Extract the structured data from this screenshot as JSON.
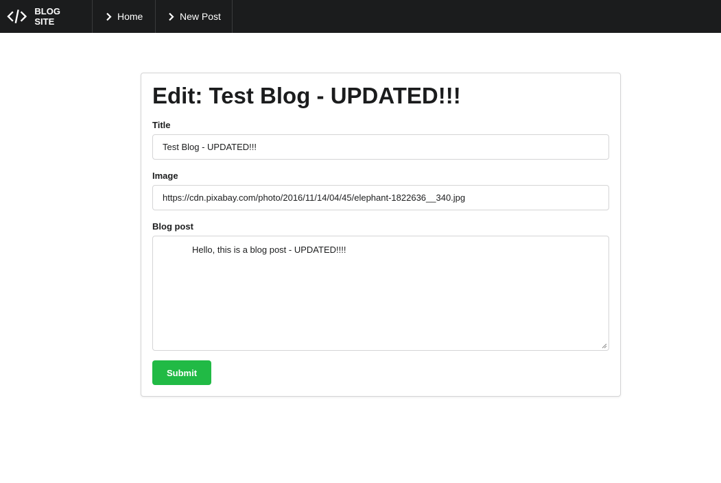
{
  "nav": {
    "brand": "BLOG SITE",
    "brand_icon": "code-icon",
    "items": [
      {
        "label": "Home",
        "icon": "chevron-right-icon"
      },
      {
        "label": "New Post",
        "icon": "chevron-right-icon"
      }
    ]
  },
  "form": {
    "heading": "Edit: Test Blog - UPDATED!!!",
    "title_label": "Title",
    "title_value": "Test Blog - UPDATED!!!",
    "image_label": "Image",
    "image_value": "https://cdn.pixabay.com/photo/2016/11/14/04/45/elephant-1822636__340.jpg",
    "body_label": "Blog post",
    "body_value": "Hello, this is a blog post - UPDATED!!!!",
    "submit_label": "Submit"
  },
  "colors": {
    "topbar": "#1b1c1d",
    "submit": "#21ba45"
  }
}
